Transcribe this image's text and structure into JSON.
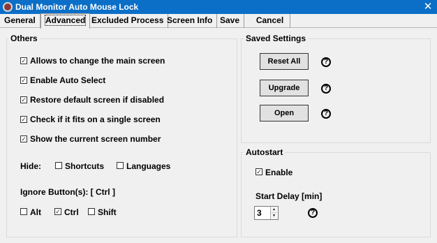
{
  "window": {
    "title": "Dual Monitor Auto Mouse Lock",
    "close_glyph": "✕"
  },
  "tabs": [
    {
      "label": "General"
    },
    {
      "label": "Advanced"
    },
    {
      "label": "Excluded Process"
    },
    {
      "label": "Screen Info"
    },
    {
      "label": "Save"
    },
    {
      "label": "Cancel"
    }
  ],
  "active_tab": "Advanced",
  "others": {
    "title": "Others",
    "options": [
      {
        "label": "Allows to change the main screen",
        "checked": true
      },
      {
        "label": "Enable Auto Select",
        "checked": true
      },
      {
        "label": "Restore default screen if disabled",
        "checked": true
      },
      {
        "label": "Check if it fits on a single screen",
        "checked": true
      },
      {
        "label": "Show the current screen number",
        "checked": true
      }
    ],
    "hide_label": "Hide:",
    "hide_options": [
      {
        "label": "Shortcuts",
        "checked": false
      },
      {
        "label": "Languages",
        "checked": false
      }
    ],
    "ignore_label": "Ignore Button(s): [ Ctrl ]",
    "ignore_options": [
      {
        "label": "Alt",
        "checked": false
      },
      {
        "label": "Ctrl",
        "checked": true
      },
      {
        "label": "Shift",
        "checked": false
      }
    ]
  },
  "saved_settings": {
    "title": "Saved Settings",
    "buttons": [
      {
        "label": "Reset All",
        "help": "?"
      },
      {
        "label": "Upgrade",
        "help": "?"
      },
      {
        "label": "Open",
        "help": "?"
      }
    ]
  },
  "autostart": {
    "title": "Autostart",
    "enable_label": "Enable",
    "enable_checked": true,
    "delay_label": "Start Delay [min]",
    "delay_value": "3",
    "help": "?",
    "spin_up_glyph": "▲",
    "spin_down_glyph": "▼"
  },
  "check_glyph": "✓",
  "colors": {
    "titlebar": "#0b6fc7",
    "background": "#f0f0f0",
    "panel_border": "#dadada"
  }
}
